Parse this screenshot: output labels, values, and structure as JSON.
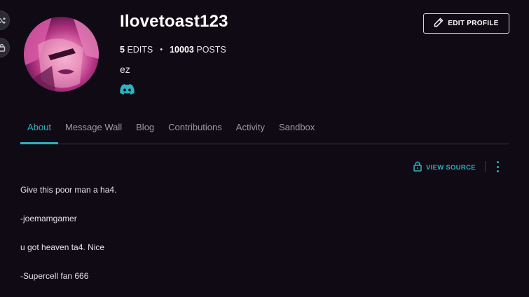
{
  "rail": {
    "buttons": [
      {
        "icon": "shuffle-icon"
      },
      {
        "icon": "lock-icon"
      }
    ]
  },
  "profile": {
    "username": "Ilovetoast123",
    "edits_count": "5",
    "edits_label": "EDITS",
    "separator": "•",
    "posts_count": "10003",
    "posts_label": "POSTS",
    "bio": "ez",
    "social_icon": "discord-icon"
  },
  "header": {
    "edit_profile_label": "EDIT PROFILE"
  },
  "tabs": [
    {
      "label": "About",
      "active": true
    },
    {
      "label": "Message Wall",
      "active": false
    },
    {
      "label": "Blog",
      "active": false
    },
    {
      "label": "Contributions",
      "active": false
    },
    {
      "label": "Activity",
      "active": false
    },
    {
      "label": "Sandbox",
      "active": false
    }
  ],
  "toolbar": {
    "view_source_label": "VIEW SOURCE"
  },
  "content": {
    "lines": [
      "Give this poor man a ha4.",
      "-joemamgamer",
      "u got heaven ta4. Nice",
      "-Supercell fan 666"
    ]
  },
  "colors": {
    "background": "#100a14",
    "accent": "#2ab3c0",
    "text": "#e6e3e8",
    "muted": "#9e9aa4"
  }
}
